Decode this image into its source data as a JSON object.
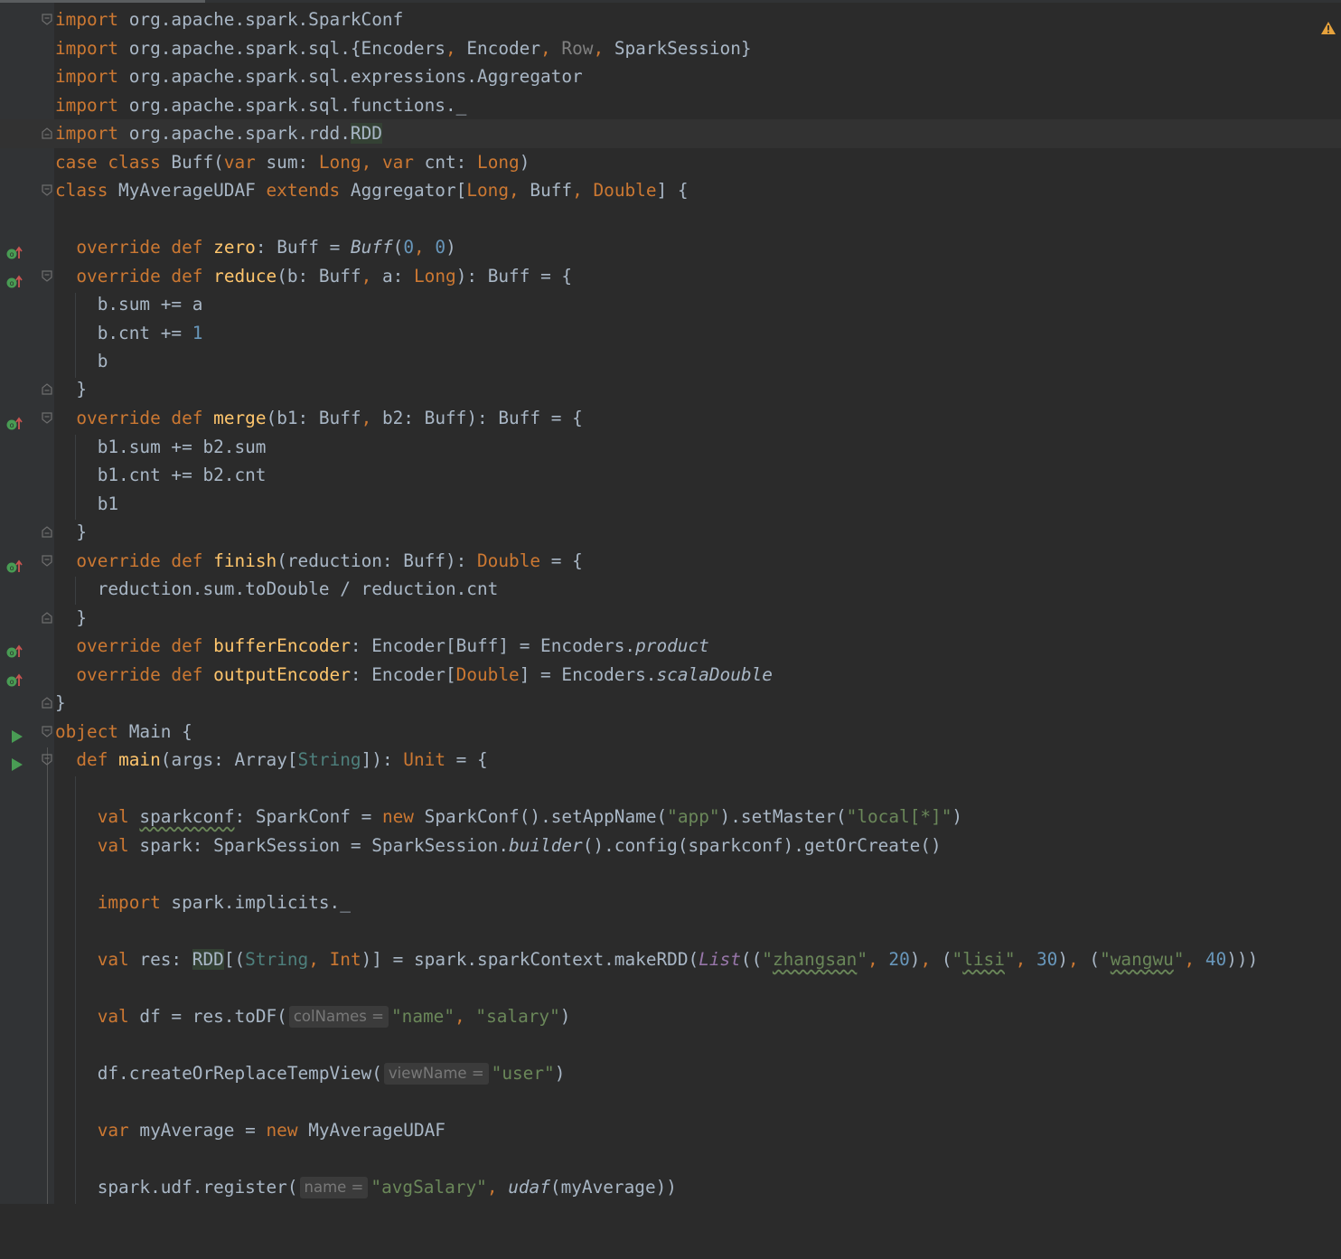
{
  "editor": {
    "language": "scala",
    "warning_icon": "warning-triangle-icon",
    "gutter_icons": {
      "override": "override-marker-icon",
      "run": "run-gutter-icon",
      "fold": "fold-marker-icon"
    },
    "colors": {
      "background": "#2b2b2b",
      "gutter": "#313335",
      "keyword": "#cc7832",
      "function": "#ffc66d",
      "number": "#6897bb",
      "string": "#6a8759",
      "text": "#a9b7c6",
      "run_arrow": "#499c54",
      "warning": "#e6a23c"
    },
    "lines": [
      "import org.apache.spark.SparkConf",
      "import org.apache.spark.sql.{Encoders, Encoder, Row, SparkSession}",
      "import org.apache.spark.sql.expressions.Aggregator",
      "import org.apache.spark.sql.functions._",
      "import org.apache.spark.rdd.RDD",
      "case class Buff(var sum: Long, var cnt: Long)",
      "class MyAverageUDAF extends Aggregator[Long, Buff, Double] {",
      "",
      "  override def zero: Buff = Buff(0, 0)",
      "  override def reduce(b: Buff, a: Long): Buff = {",
      "    b.sum += a",
      "    b.cnt += 1",
      "    b",
      "  }",
      "  override def merge(b1: Buff, b2: Buff): Buff = {",
      "    b1.sum += b2.sum",
      "    b1.cnt += b2.cnt",
      "    b1",
      "  }",
      "  override def finish(reduction: Buff): Double = {",
      "    reduction.sum.toDouble / reduction.cnt",
      "  }",
      "  override def bufferEncoder: Encoder[Buff] = Encoders.product",
      "  override def outputEncoder: Encoder[Double] = Encoders.scalaDouble",
      "}",
      "object Main {",
      "  def main(args: Array[String]): Unit = {",
      "",
      "    val sparkconf: SparkConf = new SparkConf().setAppName(\"app\").setMaster(\"local[*]\")",
      "    val spark: SparkSession = SparkSession.builder().config(sparkconf).getOrCreate()",
      "",
      "    import spark.implicits._",
      "",
      "    val res: RDD[(String, Int)] = spark.sparkContext.makeRDD(List((\"zhangsan\", 20), (\"lisi\", 30), (\"wangwu\", 40)))",
      "",
      "    val df = res.toDF(colNames = \"name\", \"salary\")",
      "",
      "    df.createOrReplaceTempView(viewName = \"user\")",
      "",
      "    var myAverage = new MyAverageUDAF",
      "",
      "    spark.udf.register(name = \"avgSalary\", udaf(myAverage))"
    ],
    "inlay_hints": [
      "colNames =",
      "viewName =",
      "name ="
    ]
  }
}
